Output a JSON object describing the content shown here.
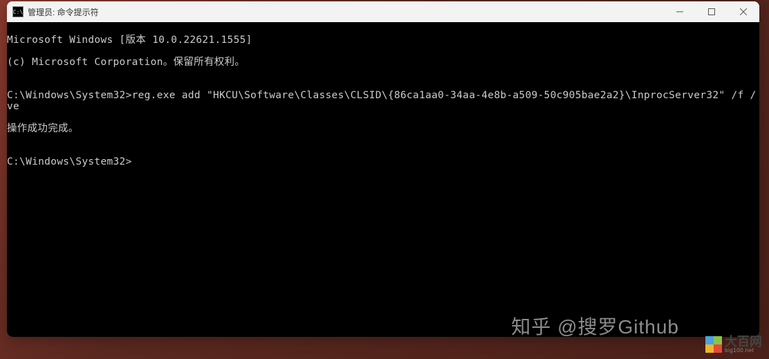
{
  "window": {
    "title": "管理员: 命令提示符",
    "icon_label": "cmd-icon"
  },
  "terminal": {
    "line1": "Microsoft Windows [版本 10.0.22621.1555]",
    "line2": "(c) Microsoft Corporation。保留所有权利。",
    "line3": "",
    "line4": "C:\\Windows\\System32>reg.exe add \"HKCU\\Software\\Classes\\CLSID\\{86ca1aa0-34aa-4e8b-a509-50c905bae2a2}\\InprocServer32\" /f /ve",
    "line5": "操作成功完成。",
    "line6": "",
    "line7": "C:\\Windows\\System32>"
  },
  "watermarks": {
    "zhihu": "知乎 @搜罗Github",
    "dabai_main": "大百网",
    "dabai_sub": "big100.net"
  }
}
